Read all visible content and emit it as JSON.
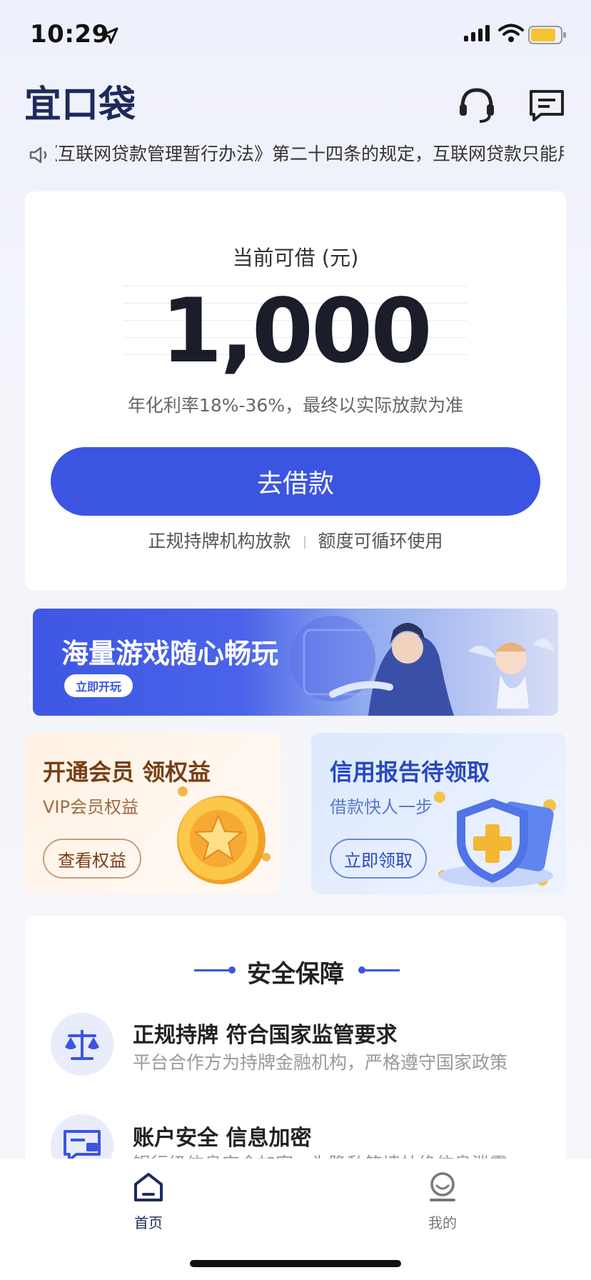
{
  "status_bar": {
    "time": "10:29"
  },
  "header": {
    "logo_text": "宜口袋"
  },
  "notice": {
    "text": "《互联网贷款管理暂行办法》第二十四条的规定，互联网贷款只能用于消费"
  },
  "loan": {
    "available_label": "当前可借 (元)",
    "amount": "1,000",
    "rate_text": "年化利率18%-36%，最终以实际放款为准",
    "button_label": "去借款",
    "feature_1": "正规持牌机构放款",
    "feature_2": "额度可循环使用"
  },
  "game_banner": {
    "title": "海量游戏随心畅玩",
    "button": "立即开玩"
  },
  "vip_card": {
    "title": "开通会员 领权益",
    "subtitle": "VIP会员权益",
    "button": "查看权益"
  },
  "credit_card": {
    "title": "信用报告待领取",
    "subtitle": "借款快人一步",
    "button": "立即领取"
  },
  "security": {
    "title": "安全保障",
    "items": [
      {
        "title": "正规持牌 符合国家监管要求",
        "desc": "平台合作方为持牌金融机构，严格遵守国家政策"
      },
      {
        "title": "账户安全 信息加密",
        "desc": "银行级信息安全加密，为隐私筑墙杜绝信息泄露"
      }
    ]
  },
  "tabbar": {
    "home_label": "首页",
    "mine_label": "我的"
  },
  "colors": {
    "accent": "#3c54e2",
    "vip_text": "#7a3d14",
    "credit_text": "#2848c2"
  }
}
